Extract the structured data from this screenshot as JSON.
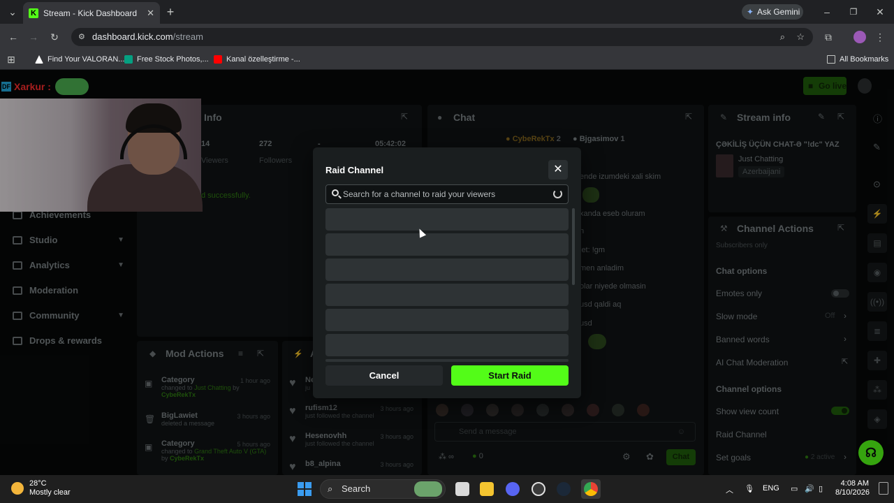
{
  "browser": {
    "tab_title": "Stream - Kick Dashboard",
    "url_host": "dashboard.kick.com",
    "url_path": "/stream",
    "ask_gemini": "Ask Gemini",
    "bookmarks": [
      "Find Your VALORAN...",
      "Free Stock Photos,...",
      "Kanal özelleştirme -..."
    ],
    "all_bookmarks": "All Bookmarks"
  },
  "overlay": {
    "brand": "Xarkur :"
  },
  "header": {
    "go_live": "Go live"
  },
  "sidebar": [
    {
      "label": "Achievements",
      "chevron": false
    },
    {
      "label": "Studio",
      "chevron": true
    },
    {
      "label": "Analytics",
      "chevron": true
    },
    {
      "label": "Moderation",
      "chevron": false
    },
    {
      "label": "Community",
      "chevron": true
    },
    {
      "label": "Drops & rewards",
      "chevron": false
    }
  ],
  "session_info": {
    "title": "Info",
    "stats": [
      {
        "value": "14",
        "label": "Viewers"
      },
      {
        "value": "272",
        "label": "Followers"
      },
      {
        "value": "-",
        "label": ""
      },
      {
        "value": "05:42:02",
        "label": ""
      }
    ],
    "status": "d successfully."
  },
  "chat": {
    "title": "Chat",
    "users": [
      "CybeRekTx",
      "Bjgasimov"
    ],
    "user_counts": [
      "2",
      "1"
    ],
    "lines": [
      "ende izumdeki xali skim",
      "xanda eseb oluram",
      "n",
      "iet: !gm",
      "men anladim",
      "olar niyede olmasin",
      "usd qaldi aq",
      "usd"
    ],
    "placeholder": "Send a message",
    "count": "0",
    "send": "Chat"
  },
  "mod_actions": {
    "title": "Mod Actions",
    "rows": [
      {
        "title": "Category",
        "line1": "changed to",
        "highlight": "Just Chatting",
        "line2": "by",
        "user": "CybeRekTx",
        "time": "1 hour ago"
      },
      {
        "title": "BigLawiet",
        "line1": "deleted a message",
        "highlight": "",
        "line2": "",
        "user": "",
        "time": "3 hours ago"
      },
      {
        "title": "Category",
        "line1": "changed to",
        "highlight": "Grand Theft Auto V (GTA)",
        "line2": "by",
        "user": "CybeRekTx",
        "time": "5 hours ago"
      }
    ]
  },
  "activity": {
    "title": "A",
    "rows": [
      {
        "name": "Ne",
        "text": "ju",
        "time": ""
      },
      {
        "name": "rufism12",
        "text": "just followed the channel",
        "time": "3 hours ago"
      },
      {
        "name": "Hesenovhh",
        "text": "just followed the channel",
        "time": "3 hours ago"
      },
      {
        "name": "b8_alpina",
        "text": "",
        "time": "3 hours ago"
      }
    ]
  },
  "stream_info": {
    "title": "Stream info",
    "stream_title": "ÇƏKİLİŞ ÜÇÜN CHAT-Ə \"!dc\" YAZ",
    "category": "Just Chatting",
    "tag": "Azerbaijani"
  },
  "channel_actions": {
    "title": "Channel Actions",
    "cut": "Subscribers only",
    "chat_options_title": "Chat options",
    "chat_options": [
      {
        "label": "Emotes only",
        "value": "",
        "control": "toggle-off"
      },
      {
        "label": "Slow mode",
        "value": "Off",
        "control": "chevron"
      },
      {
        "label": "Banned words",
        "value": "",
        "control": "chevron"
      },
      {
        "label": "AI Chat Moderation",
        "value": "",
        "control": "external"
      }
    ],
    "channel_options_title": "Channel options",
    "channel_options": [
      {
        "label": "Show view count",
        "value": "",
        "control": "toggle-on"
      },
      {
        "label": "Raid Channel",
        "value": "",
        "control": "none"
      },
      {
        "label": "Set goals",
        "value": "2 active",
        "control": "chevron"
      }
    ]
  },
  "modal": {
    "title": "Raid Channel",
    "search_placeholder": "Search for a channel to raid your viewers",
    "skeleton_rows": 6,
    "cancel": "Cancel",
    "start": "Start Raid"
  },
  "taskbar": {
    "temp": "28°C",
    "weather": "Mostly clear",
    "search": "Search",
    "lang": "ENG",
    "time": "4:08 AM",
    "date": "8/10/2026"
  },
  "colors": {
    "kick_green": "#53fc18",
    "modal_bg": "#1a1e1f",
    "page_bg": "#070909"
  }
}
